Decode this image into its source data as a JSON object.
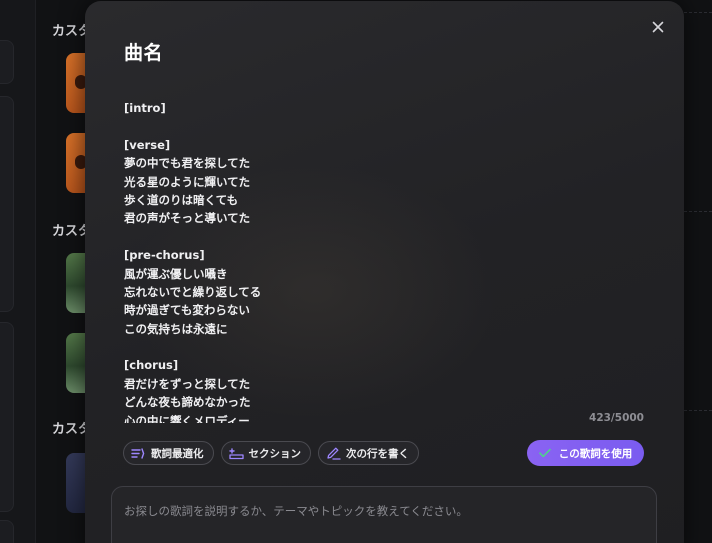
{
  "background": {
    "section_labels": [
      "カスタ",
      "カスタ",
      "カスタ"
    ]
  },
  "modal": {
    "title": "曲名",
    "lyrics": [
      "[intro]",
      "",
      "[verse]",
      "夢の中でも君を探してた",
      "光る星のように輝いてた",
      "歩く道のりは暗くても",
      "君の声がそっと導いてた",
      "",
      "[pre-chorus]",
      "風が運ぶ優しい囁き",
      "忘れないでと繰り返してる",
      "時が過ぎても変わらない",
      "この気持ちは永遠に",
      "",
      "[chorus]",
      "君だけをずっと探してた",
      "どんな夜も諦めなかった",
      "心の中に響くメロディー"
    ],
    "char_count": "423/5000",
    "tools": {
      "optimize_label": "歌詞最適化",
      "section_label": "セクション",
      "next_line_label": "次の行を書く"
    },
    "use_button_label": "この歌詞を使用",
    "prompt": {
      "value": "",
      "placeholder": "お探しの歌詞を説明するか、テーマやトピックを教えてください。"
    }
  },
  "colors": {
    "accent": "#7d5ff0",
    "icon_purple": "#9d86ff",
    "check_green": "#4fd18b"
  },
  "icons": {
    "close": "close-icon",
    "optimize": "optimize-lines-icon",
    "section": "section-insert-icon",
    "next_line": "pencil-icon",
    "use": "check-icon"
  }
}
